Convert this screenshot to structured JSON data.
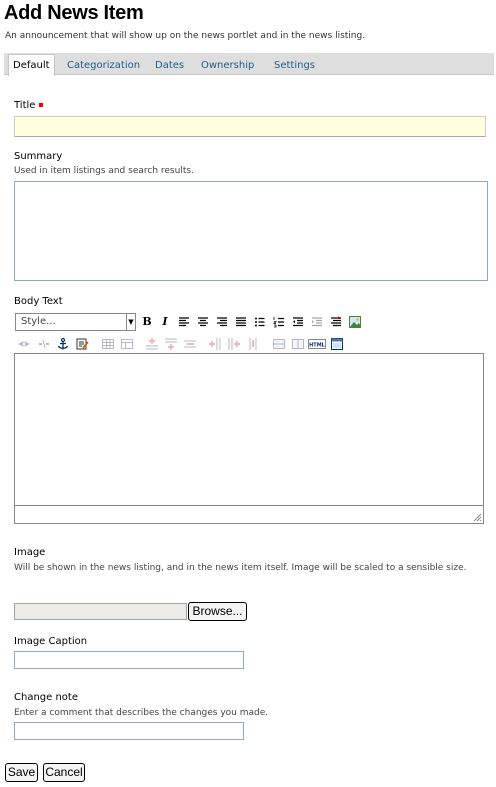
{
  "page": {
    "title": "Add News Item",
    "description": "An announcement that will show up on the news portlet and in the news listing."
  },
  "tabs": [
    {
      "label": "Default",
      "active": true
    },
    {
      "label": "Categorization",
      "active": false
    },
    {
      "label": "Dates",
      "active": false
    },
    {
      "label": "Ownership",
      "active": false
    },
    {
      "label": "Settings",
      "active": false
    }
  ],
  "fields": {
    "title": {
      "label": "Title",
      "required": true,
      "value": ""
    },
    "summary": {
      "label": "Summary",
      "help": "Used in item listings and search results.",
      "value": ""
    },
    "body": {
      "label": "Body Text",
      "style_select": "Style..."
    },
    "image": {
      "label": "Image",
      "help": "Will be shown in the news listing, and in the news item itself. Image will be scaled to a sensible size.",
      "browse_label": "Browse..."
    },
    "image_caption": {
      "label": "Image Caption",
      "value": ""
    },
    "change_note": {
      "label": "Change note",
      "help": "Enter a comment that describes the changes you made.",
      "value": ""
    }
  },
  "toolbar": {
    "bold": "B",
    "italic": "I",
    "html": "HTML"
  },
  "buttons": {
    "save": "Save",
    "cancel": "Cancel"
  },
  "colors": {
    "link": "#205c90",
    "required": "#ff0000",
    "title_field_bg": "#ffffe0",
    "field_border": "#8cacbb"
  }
}
